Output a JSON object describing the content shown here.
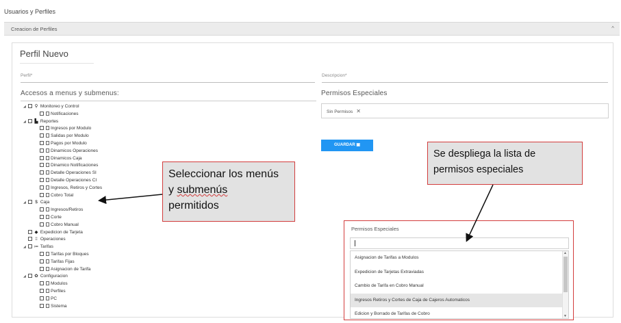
{
  "page_title": "Usuarios y Perfiles",
  "section": {
    "label": "Creacion de Perfiles",
    "chevron_icon": "chevron-up-icon"
  },
  "card": {
    "title": "Perfil Nuevo",
    "perfil_label": "Perfil*",
    "descripcion_label": "Descripcion*",
    "accesos_heading": "Accesos a menus y submenus:",
    "permisos_heading": "Permisos Especiales",
    "chip": {
      "label": "Sin Permisos",
      "remove": "✕"
    },
    "save_button": "GUARDAR"
  },
  "tree": [
    {
      "label": "Monitoreo y Control",
      "level": 0,
      "expand": true,
      "icon": "search-icon"
    },
    {
      "label": "Notificaciones",
      "level": 1,
      "icon": "doc-icon"
    },
    {
      "label": "Reportes",
      "level": 0,
      "expand": true,
      "icon": "file-icon"
    },
    {
      "label": "Ingresos por Modulo",
      "level": 1,
      "icon": "doc-icon"
    },
    {
      "label": "Salidas por Modulo",
      "level": 1,
      "icon": "doc-icon"
    },
    {
      "label": "Pagos por Modulo",
      "level": 1,
      "icon": "doc-icon"
    },
    {
      "label": "Dinamicos Operaciones",
      "level": 1,
      "icon": "doc-icon"
    },
    {
      "label": "Dinamicos Caja",
      "level": 1,
      "icon": "doc-icon"
    },
    {
      "label": "Dinamico Notificaciones",
      "level": 1,
      "icon": "doc-icon"
    },
    {
      "label": "Detalle Operaciones SI",
      "level": 1,
      "icon": "doc-icon"
    },
    {
      "label": "Detalle Operaciones CI",
      "level": 1,
      "icon": "doc-icon"
    },
    {
      "label": "Ingresos, Retiros y Cortes",
      "level": 1,
      "icon": "doc-icon"
    },
    {
      "label": "Cobro Total",
      "level": 1,
      "icon": "doc-icon"
    },
    {
      "label": "Caja",
      "level": 0,
      "expand": true,
      "icon": "dollar-icon"
    },
    {
      "label": "Ingresos/Retiros",
      "level": 1,
      "icon": "doc-icon"
    },
    {
      "label": "Corte",
      "level": 1,
      "icon": "doc-icon"
    },
    {
      "label": "Cobro Manual",
      "level": 1,
      "icon": "doc-icon"
    },
    {
      "label": "Expedicion de Tarjeta",
      "level": 0,
      "expand": false,
      "icon": "tag-icon"
    },
    {
      "label": "Operaciones",
      "level": 0,
      "expand": false,
      "icon": "grid-icon"
    },
    {
      "label": "Tarifas",
      "level": 0,
      "expand": true,
      "icon": "list-icon"
    },
    {
      "label": "Tarifas por Bloques",
      "level": 1,
      "icon": "doc-icon"
    },
    {
      "label": "Tarifas Fijas",
      "level": 1,
      "icon": "doc-icon"
    },
    {
      "label": "Asignacion de Tarifa",
      "level": 1,
      "icon": "doc-icon"
    },
    {
      "label": "Configuracion",
      "level": 0,
      "expand": true,
      "icon": "gear-icon"
    },
    {
      "label": "Modulos",
      "level": 1,
      "icon": "doc-icon"
    },
    {
      "label": "Perfiles",
      "level": 1,
      "icon": "doc-icon"
    },
    {
      "label": "PC",
      "level": 1,
      "icon": "doc-icon"
    },
    {
      "label": "Sistema",
      "level": 1,
      "icon": "doc-icon"
    }
  ],
  "callouts": {
    "left_line1": "Seleccionar los menús",
    "left_line2a": "y ",
    "left_line2b": "submenús",
    "left_line3": "permitidos",
    "right_line1": "Se despliega la lista de",
    "right_line2": "permisos especiales"
  },
  "dropdown": {
    "title": "Permisos Especiales",
    "options": [
      "Asignacion de Tarifas a Modulos",
      "Expedicion de Tarjetas Extraviadas",
      "Cambio de Tarifa en Cobro Manual",
      "Ingresos Retiros y Cortes de Caja de Cajeros Automaticos",
      "Edicion y Borrado de Tarifas de Cobro"
    ],
    "highlighted_index": 3
  },
  "colors": {
    "accent": "#2196f3",
    "callout_border": "#d23b3b",
    "callout_bg": "#e2e2e2"
  }
}
